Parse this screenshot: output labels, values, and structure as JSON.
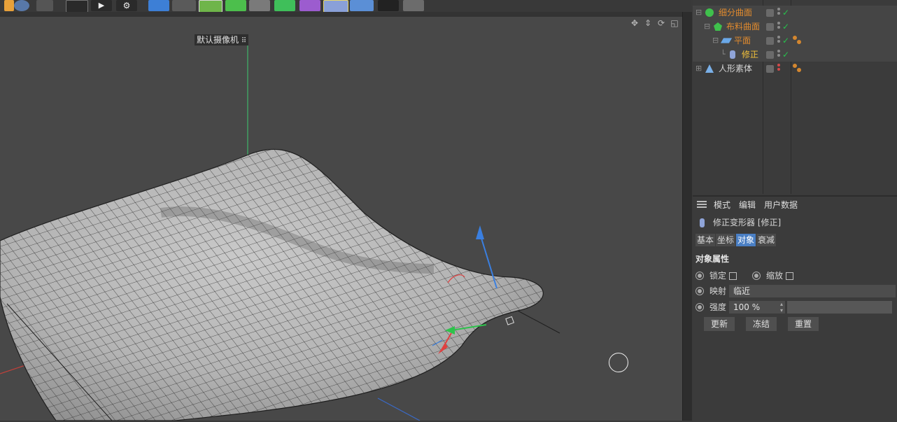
{
  "viewport": {
    "camera_label": "默认摄像机",
    "camera_icon": "camera-icon",
    "nav_icons": [
      "move-view-icon",
      "dolly-view-icon",
      "rotate-view-icon",
      "toggle-view-icon"
    ]
  },
  "toolbar": {
    "icons": [
      "z-axis-lock-icon",
      "coordinate-system-icon",
      "render-region-icon",
      "render-view-icon",
      "render-settings-icon",
      "cube-primitive-icon",
      "spline-pen-icon",
      "subdivision-surface-icon",
      "extrude-icon",
      "mograph-cloner-icon",
      "array-icon",
      "deformer-bend-icon",
      "tag-icon",
      "floor-icon",
      "camera-icon",
      "light-icon"
    ]
  },
  "objects": [
    {
      "name": "细分曲面",
      "icon": "subdivision-surface-icon",
      "color": "#e08a2e"
    },
    {
      "name": "布料曲面",
      "icon": "cloth-surface-icon",
      "color": "#e08a2e"
    },
    {
      "name": "平面",
      "icon": "plane-icon",
      "color": "#e08a2e"
    },
    {
      "name": "修正",
      "icon": "correction-deformer-icon",
      "color": "#f2c13a"
    },
    {
      "name": "人形素体",
      "icon": "figure-icon",
      "color": "#d6d6d6"
    }
  ],
  "attributes": {
    "menu": [
      "模式",
      "编辑",
      "用户数据"
    ],
    "title": "修正变形器 [修正]",
    "tabs": [
      "基本",
      "坐标",
      "对象",
      "衰减"
    ],
    "active_tab": "对象",
    "section_title": "对象属性",
    "lock_label": "锁定",
    "scale_label": "缩放",
    "mapping_label": "映射",
    "mapping_value": "临近",
    "strength_label": "强度",
    "strength_value": "100 %",
    "buttons": [
      "更新",
      "冻结",
      "重置"
    ]
  },
  "colors": {
    "accent_tab": "#4a7fc4",
    "check_green": "#27c24c",
    "tag_orange": "#d4872f"
  }
}
